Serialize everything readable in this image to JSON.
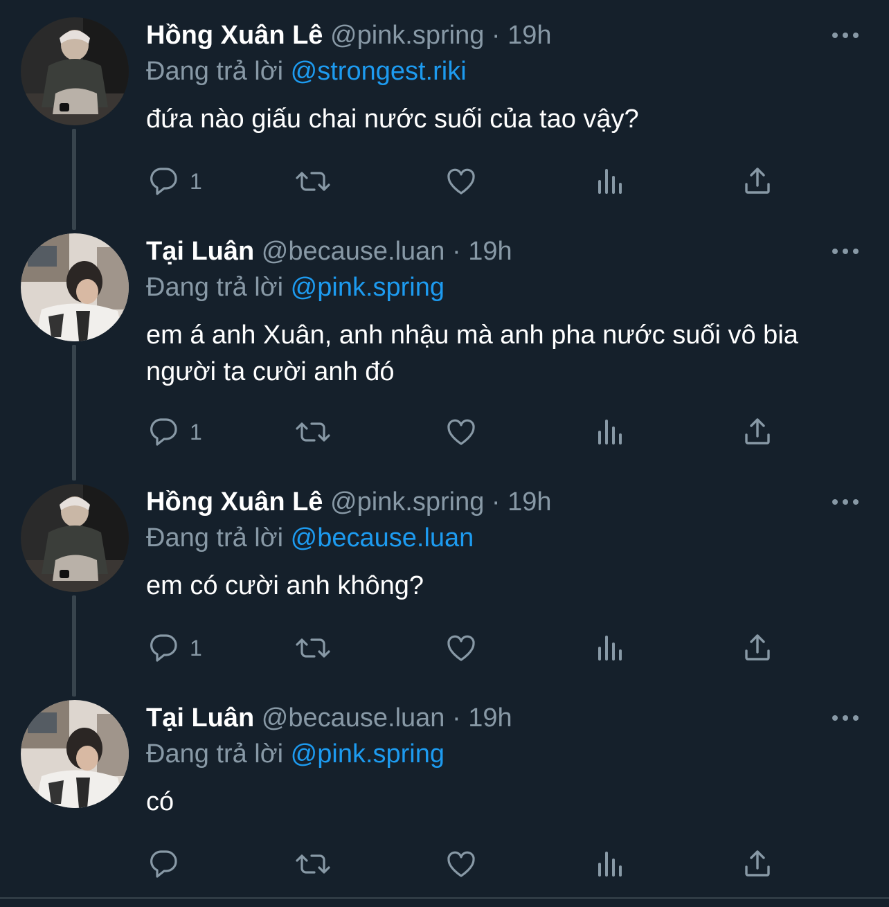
{
  "colors": {
    "background": "#15202b",
    "text": "#ffffff",
    "secondary_text": "#8899a6",
    "mention": "#1d9bf0",
    "thread_line": "#38444d"
  },
  "reply_prefix": "Đang trả lời",
  "separator": "·",
  "tweets": [
    {
      "display_name": "Hồng Xuân Lê",
      "handle": "@pink.spring",
      "time": "19h",
      "reply_to": "@strongest.riki",
      "text": "đứa nào giấu chai nước suối của tao vậy?",
      "reply_count": "1",
      "avatar": "avatar-hong-xuan-le"
    },
    {
      "display_name": "Tại Luân",
      "handle": "@because.luan",
      "time": "19h",
      "reply_to": "@pink.spring",
      "text": "em á anh Xuân, anh nhậu mà anh pha nước suối vô bia người ta cười anh đó",
      "reply_count": "1",
      "avatar": "avatar-tai-luan"
    },
    {
      "display_name": "Hồng Xuân Lê",
      "handle": "@pink.spring",
      "time": "19h",
      "reply_to": "@because.luan",
      "text": "em có cười anh không?",
      "reply_count": "1",
      "avatar": "avatar-hong-xuan-le"
    },
    {
      "display_name": "Tại Luân",
      "handle": "@because.luan",
      "time": "19h",
      "reply_to": "@pink.spring",
      "text": "có",
      "reply_count": "",
      "avatar": "avatar-tai-luan"
    }
  ],
  "action_icons": [
    "reply-icon",
    "retweet-icon",
    "like-icon",
    "analytics-icon",
    "share-icon"
  ]
}
